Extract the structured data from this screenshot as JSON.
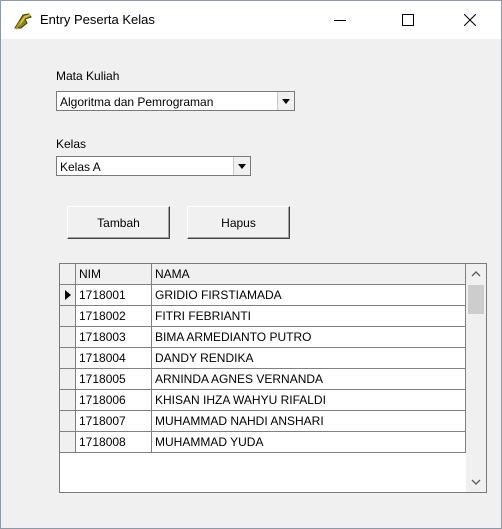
{
  "window": {
    "title": "Entry Peserta Kelas"
  },
  "mata_kuliah": {
    "label": "Mata Kuliah",
    "value": "Algoritma dan Pemrograman"
  },
  "kelas": {
    "label": "Kelas",
    "value": "Kelas A"
  },
  "buttons": {
    "tambah": "Tambah",
    "hapus": "Hapus"
  },
  "grid": {
    "columns": [
      "NIM",
      "NAMA"
    ],
    "rows": [
      {
        "nim": "1718001",
        "nama": "GRIDIO FIRSTIAMADA"
      },
      {
        "nim": "1718002",
        "nama": "FITRI FEBRIANTI"
      },
      {
        "nim": "1718003",
        "nama": "BIMA ARMEDIANTO PUTRO"
      },
      {
        "nim": "1718004",
        "nama": "DANDY RENDIKA"
      },
      {
        "nim": "1718005",
        "nama": "ARNINDA AGNES VERNANDA"
      },
      {
        "nim": "1718006",
        "nama": "KHISAN IHZA WAHYU RIFALDI"
      },
      {
        "nim": "1718007",
        "nama": "MUHAMMAD NAHDI ANSHARI"
      },
      {
        "nim": "1718008",
        "nama": "MUHAMMAD YUDA"
      }
    ]
  },
  "icons": {
    "app": "delphi-helmet-icon",
    "minimize": "minimize-icon",
    "maximize": "maximize-icon",
    "close": "close-icon",
    "dropdown": "chevron-down-icon",
    "row_indicator": "row-pointer-icon",
    "scroll_up": "chevron-up-icon",
    "scroll_down": "chevron-down-icon"
  }
}
